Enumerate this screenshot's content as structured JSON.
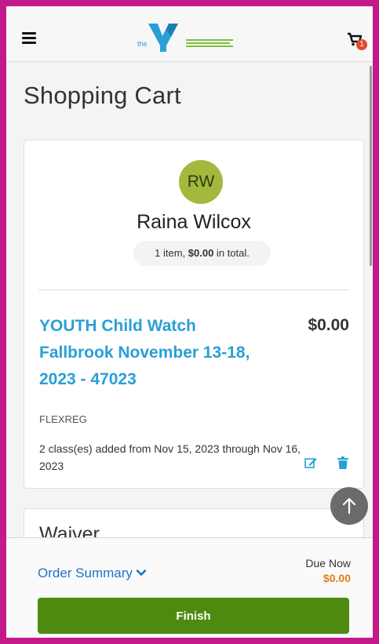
{
  "header": {
    "logo_text": "the Y",
    "logo_tagline": [
      "FOR YOUTH DEVELOPMENT",
      "FOR HEALTHY LIVING",
      "FOR SOCIAL RESPONSIBILITY"
    ],
    "cart_count": "1"
  },
  "page": {
    "title": "Shopping Cart"
  },
  "cart": {
    "customer_initials": "RW",
    "customer_name": "Raina Wilcox",
    "summary_count": "1 item, ",
    "summary_total": "$0.00",
    "summary_suffix": " in total.",
    "item": {
      "title": "YOUTH Child Watch Fallbrook November 13-18, 2023 - 47023",
      "price": "$0.00",
      "code": "FLEXREG",
      "description": "2 class(es) added from Nov 15, 2023 through Nov 16, 2023"
    }
  },
  "waiver": {
    "title": "Waiver"
  },
  "footer": {
    "order_summary_label": "Order Summary",
    "due_label": "Due Now",
    "due_amount": "$0.00",
    "finish_label": "Finish"
  },
  "colors": {
    "frame_border": "#c4198b",
    "link_blue": "#2a9fd6",
    "avatar_green": "#a3b93d",
    "finish_green": "#4f8a10",
    "due_orange": "#e07e1a"
  }
}
